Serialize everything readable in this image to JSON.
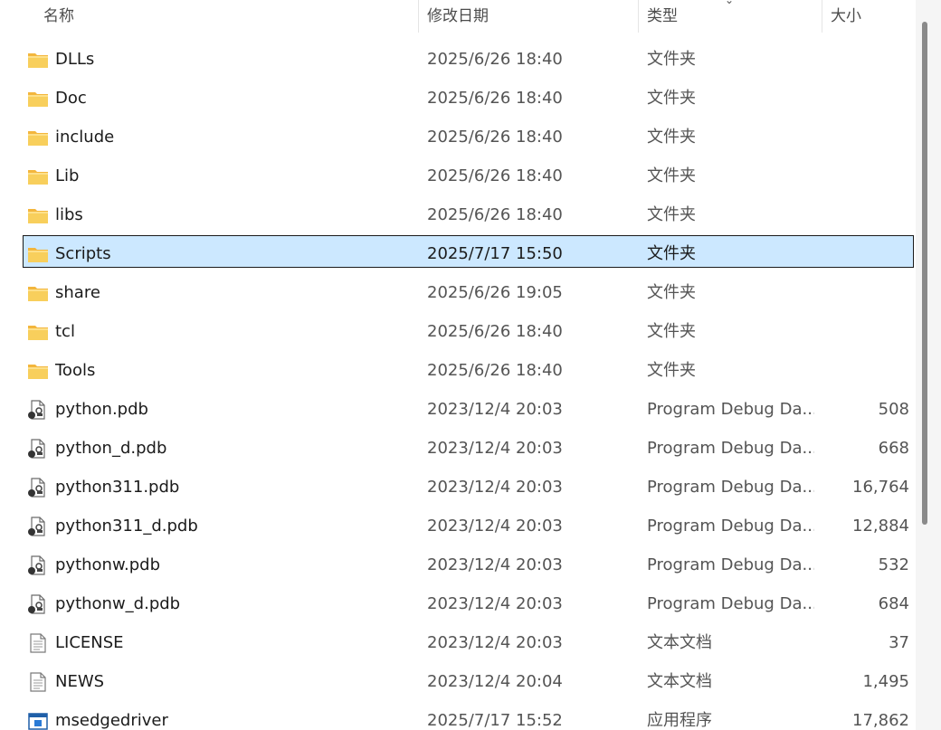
{
  "columns": {
    "name": "名称",
    "modified": "修改日期",
    "type": "类型",
    "size": "大小"
  },
  "files": [
    {
      "name": "DLLs",
      "modified": "2025/6/26 18:40",
      "type": "文件夹",
      "size": "",
      "icon": "folder-icon",
      "selected": false
    },
    {
      "name": "Doc",
      "modified": "2025/6/26 18:40",
      "type": "文件夹",
      "size": "",
      "icon": "folder-icon",
      "selected": false
    },
    {
      "name": "include",
      "modified": "2025/6/26 18:40",
      "type": "文件夹",
      "size": "",
      "icon": "folder-icon",
      "selected": false
    },
    {
      "name": "Lib",
      "modified": "2025/6/26 18:40",
      "type": "文件夹",
      "size": "",
      "icon": "folder-icon",
      "selected": false
    },
    {
      "name": "libs",
      "modified": "2025/6/26 18:40",
      "type": "文件夹",
      "size": "",
      "icon": "folder-icon",
      "selected": false
    },
    {
      "name": "Scripts",
      "modified": "2025/7/17 15:50",
      "type": "文件夹",
      "size": "",
      "icon": "folder-icon",
      "selected": true
    },
    {
      "name": "share",
      "modified": "2025/6/26 19:05",
      "type": "文件夹",
      "size": "",
      "icon": "folder-icon",
      "selected": false
    },
    {
      "name": "tcl",
      "modified": "2025/6/26 18:40",
      "type": "文件夹",
      "size": "",
      "icon": "folder-icon",
      "selected": false
    },
    {
      "name": "Tools",
      "modified": "2025/6/26 18:40",
      "type": "文件夹",
      "size": "",
      "icon": "folder-icon",
      "selected": false
    },
    {
      "name": "python.pdb",
      "modified": "2023/12/4 20:03",
      "type": "Program Debug Da...",
      "size": "508",
      "icon": "pdb-file-icon",
      "selected": false
    },
    {
      "name": "python_d.pdb",
      "modified": "2023/12/4 20:03",
      "type": "Program Debug Da...",
      "size": "668",
      "icon": "pdb-file-icon",
      "selected": false
    },
    {
      "name": "python311.pdb",
      "modified": "2023/12/4 20:03",
      "type": "Program Debug Da...",
      "size": "16,764",
      "icon": "pdb-file-icon",
      "selected": false
    },
    {
      "name": "python311_d.pdb",
      "modified": "2023/12/4 20:03",
      "type": "Program Debug Da...",
      "size": "12,884",
      "icon": "pdb-file-icon",
      "selected": false
    },
    {
      "name": "pythonw.pdb",
      "modified": "2023/12/4 20:03",
      "type": "Program Debug Da...",
      "size": "532",
      "icon": "pdb-file-icon",
      "selected": false
    },
    {
      "name": "pythonw_d.pdb",
      "modified": "2023/12/4 20:03",
      "type": "Program Debug Da...",
      "size": "684",
      "icon": "pdb-file-icon",
      "selected": false
    },
    {
      "name": "LICENSE",
      "modified": "2023/12/4 20:03",
      "type": "文本文档",
      "size": "37",
      "icon": "text-file-icon",
      "selected": false
    },
    {
      "name": "NEWS",
      "modified": "2023/12/4 20:04",
      "type": "文本文档",
      "size": "1,495",
      "icon": "text-file-icon",
      "selected": false
    },
    {
      "name": "msedgedriver",
      "modified": "2025/7/17 15:52",
      "type": "应用程序",
      "size": "17,862",
      "icon": "application-icon",
      "selected": false
    }
  ],
  "colors": {
    "selection_bg": "#cce8ff",
    "folder": "#f8c94a"
  }
}
